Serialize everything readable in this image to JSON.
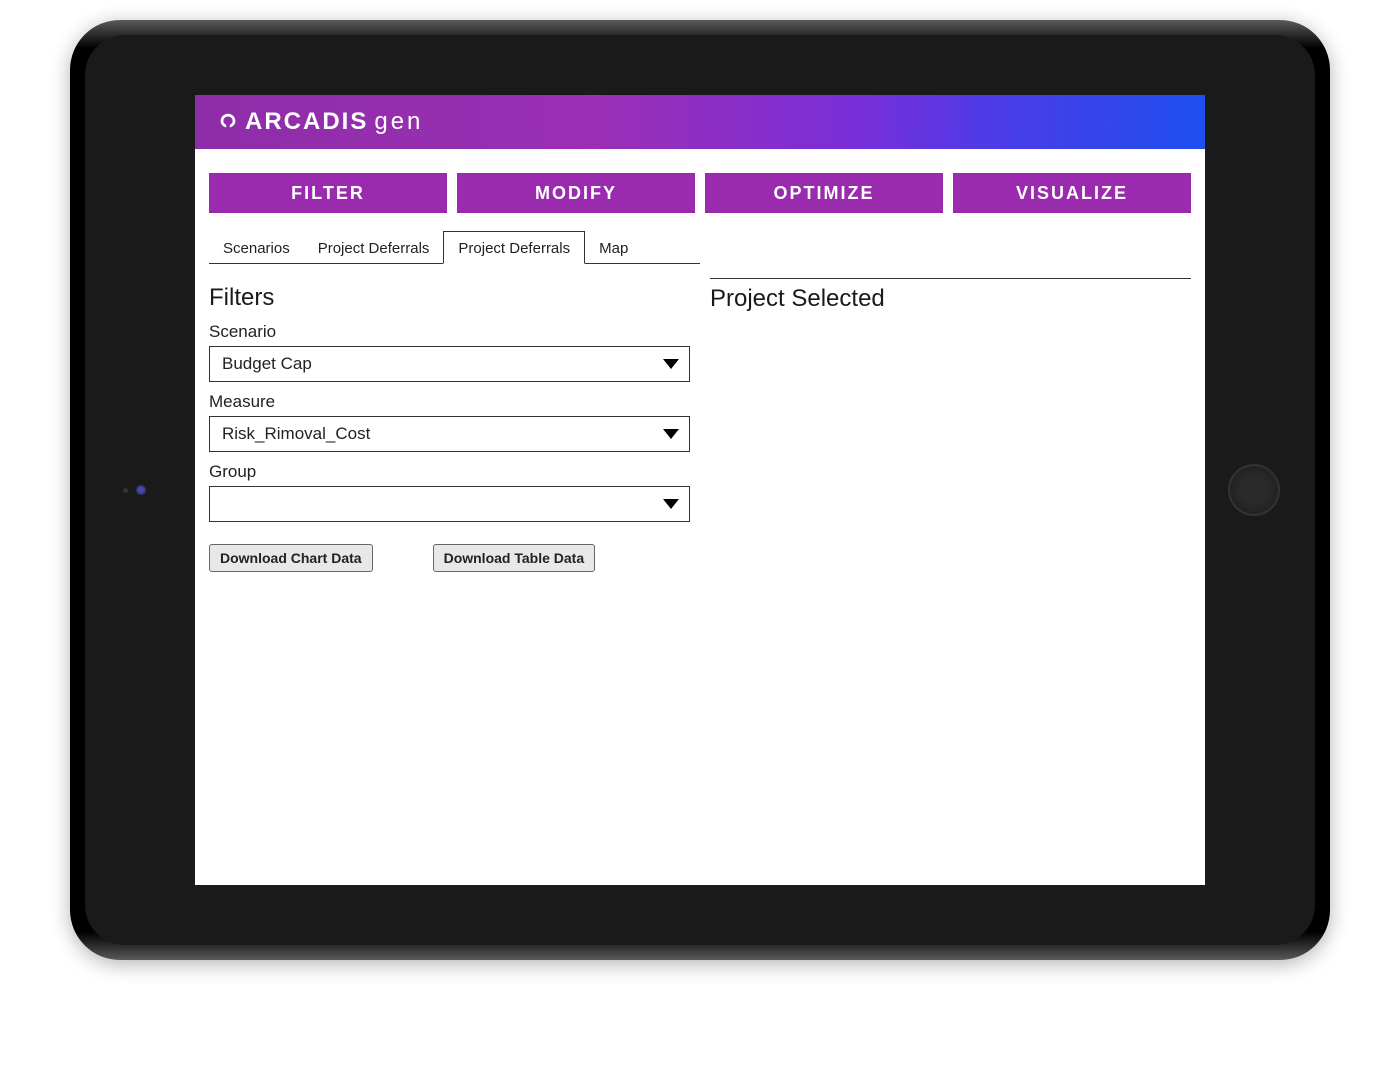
{
  "brand": {
    "name_bold": "ARCADIS",
    "name_light": "gen"
  },
  "nav": {
    "filter": "FILTER",
    "modify": "MODIFY",
    "optimize": "OPTIMIZE",
    "visualize": "VISUALIZE"
  },
  "tabs": {
    "scenarios": "Scenarios",
    "proj_def_1": "Project Deferrals",
    "proj_def_2": "Project Deferrals",
    "map": "Map"
  },
  "left": {
    "title": "Filters",
    "scenario_label": "Scenario",
    "scenario_value": "Budget Cap",
    "measure_label": "Measure",
    "measure_value": "Risk_Rimoval_Cost",
    "group_label": "Group",
    "group_value": "",
    "download_chart": "Download Chart Data",
    "download_table": "Download Table Data"
  },
  "right": {
    "title": "Project Selected"
  }
}
